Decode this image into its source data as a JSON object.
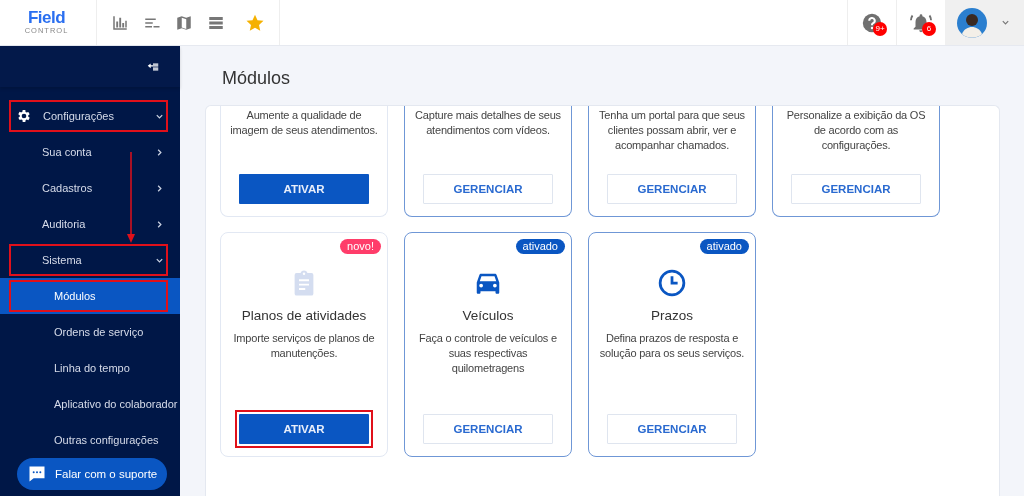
{
  "header": {
    "logo": {
      "name": "Field",
      "tagline": "CONTROL"
    },
    "toolbar": [
      {
        "kind": "chart"
      },
      {
        "kind": "list"
      },
      {
        "kind": "map"
      },
      {
        "kind": "table"
      },
      {
        "kind": "star"
      }
    ],
    "alerts": [
      {
        "kind": "help",
        "badge": "9+"
      },
      {
        "kind": "bell",
        "badge": "6"
      }
    ]
  },
  "sidebar": {
    "items": [
      {
        "label": "Configurações",
        "kind": "gear",
        "expanded": true,
        "selected": false,
        "highlighted": true,
        "children": [
          {
            "label": "Sua conta",
            "expanded": false,
            "selected": false,
            "highlighted": false
          },
          {
            "label": "Cadastros",
            "expanded": false,
            "selected": false,
            "highlighted": false
          },
          {
            "label": "Auditoria",
            "expanded": false,
            "selected": false,
            "highlighted": false
          },
          {
            "label": "Sistema",
            "expanded": true,
            "selected": false,
            "highlighted": true,
            "children": [
              {
                "label": "Módulos",
                "selected": true,
                "highlighted": true
              },
              {
                "label": "Ordens de serviço",
                "selected": false,
                "highlighted": false
              },
              {
                "label": "Linha do tempo",
                "selected": false,
                "highlighted": false
              },
              {
                "label": "Aplicativo do colaborador",
                "selected": false,
                "highlighted": false
              },
              {
                "label": "Outras configurações",
                "selected": false,
                "highlighted": false
              }
            ]
          }
        ]
      }
    ],
    "annotation_arrow": true,
    "support_button": "Falar com o suporte"
  },
  "page_title": "Módulos",
  "modules": [
    {
      "description": "Aumente a qualidade de imagem de seus atendimentos.",
      "active": false,
      "button": {
        "label": "ATIVAR",
        "kind": "activate",
        "highlighted": false
      }
    },
    {
      "description": "Capture mais detalhes de seus atendimentos com vídeos.",
      "active": true,
      "button": {
        "label": "GERENCIAR",
        "kind": "manage",
        "highlighted": false
      }
    },
    {
      "description": "Tenha um portal para que seus clientes possam abrir, ver e acompanhar chamados.",
      "active": true,
      "button": {
        "label": "GERENCIAR",
        "kind": "manage",
        "highlighted": false
      }
    },
    {
      "description": "Personalize a exibição da OS de acordo com as configurações.",
      "active": true,
      "button": {
        "label": "GERENCIAR",
        "kind": "manage",
        "highlighted": false
      }
    },
    {
      "title": "Planos de atividades",
      "kind": "clipboard",
      "badge": {
        "text": "novo!",
        "kind": "new"
      },
      "description": "Importe serviços de planos de manutenções.",
      "active": false,
      "button": {
        "label": "ATIVAR",
        "kind": "activate",
        "highlighted": true
      }
    },
    {
      "title": "Veículos",
      "kind": "car",
      "badge": {
        "text": "ativado",
        "kind": "enabled"
      },
      "description": "Faça o controle de veículos e suas respectivas quilometragens",
      "active": true,
      "button": {
        "label": "GERENCIAR",
        "kind": "manage",
        "highlighted": false
      }
    },
    {
      "title": "Prazos",
      "kind": "clock",
      "badge": {
        "text": "ativado",
        "kind": "enabled"
      },
      "description": "Defina prazos de resposta e solução para os seus serviços.",
      "active": true,
      "button": {
        "label": "GERENCIAR",
        "kind": "manage",
        "highlighted": false
      }
    }
  ]
}
